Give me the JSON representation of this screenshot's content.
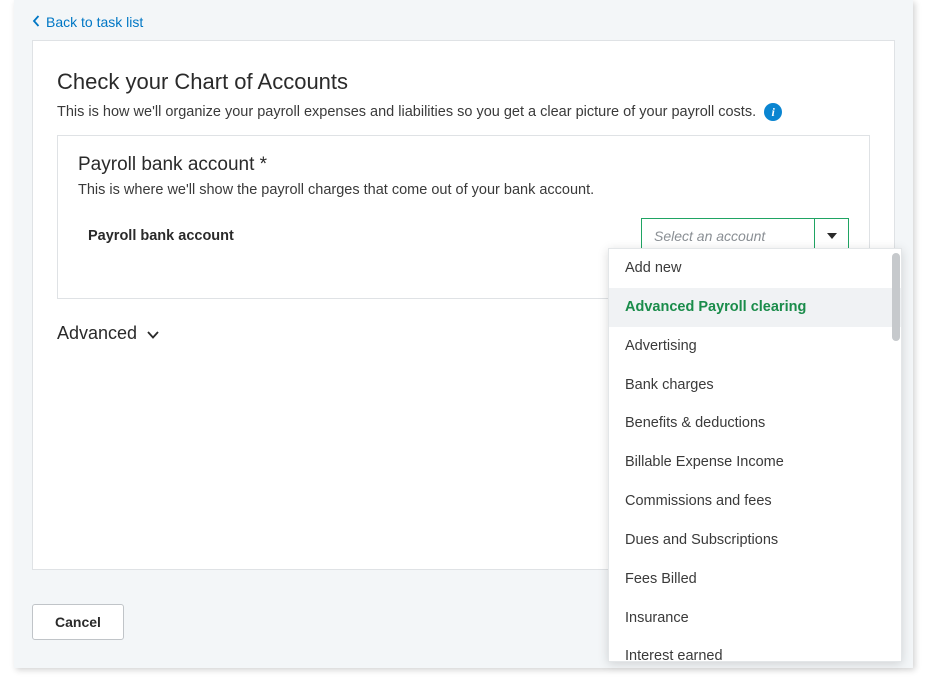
{
  "nav": {
    "back_label": "Back to task list"
  },
  "page": {
    "title": "Check your Chart of Accounts",
    "subtitle": "This is how we'll organize your payroll expenses and liabilities so you get a clear picture of your payroll costs."
  },
  "section": {
    "title": "Payroll bank account *",
    "description": "This is where we'll show the payroll charges that come out of your bank account.",
    "field_label": "Payroll bank account",
    "select_placeholder": "Select an account"
  },
  "advanced_label": "Advanced",
  "buttons": {
    "cancel": "Cancel"
  },
  "dropdown_options": [
    {
      "label": "Add new",
      "selected": false
    },
    {
      "label": "Advanced Payroll clearing",
      "selected": true
    },
    {
      "label": "Advertising",
      "selected": false
    },
    {
      "label": "Bank charges",
      "selected": false
    },
    {
      "label": "Benefits & deductions",
      "selected": false
    },
    {
      "label": "Billable Expense Income",
      "selected": false
    },
    {
      "label": "Commissions and fees",
      "selected": false
    },
    {
      "label": "Dues and Subscriptions",
      "selected": false
    },
    {
      "label": "Fees Billed",
      "selected": false
    },
    {
      "label": "Insurance",
      "selected": false
    },
    {
      "label": "Interest earned",
      "selected": false
    }
  ],
  "colors": {
    "link": "#0077c5",
    "accent_green": "#1fa463",
    "selected_green": "#1a8c4a",
    "info_blue": "#0a85d1"
  }
}
